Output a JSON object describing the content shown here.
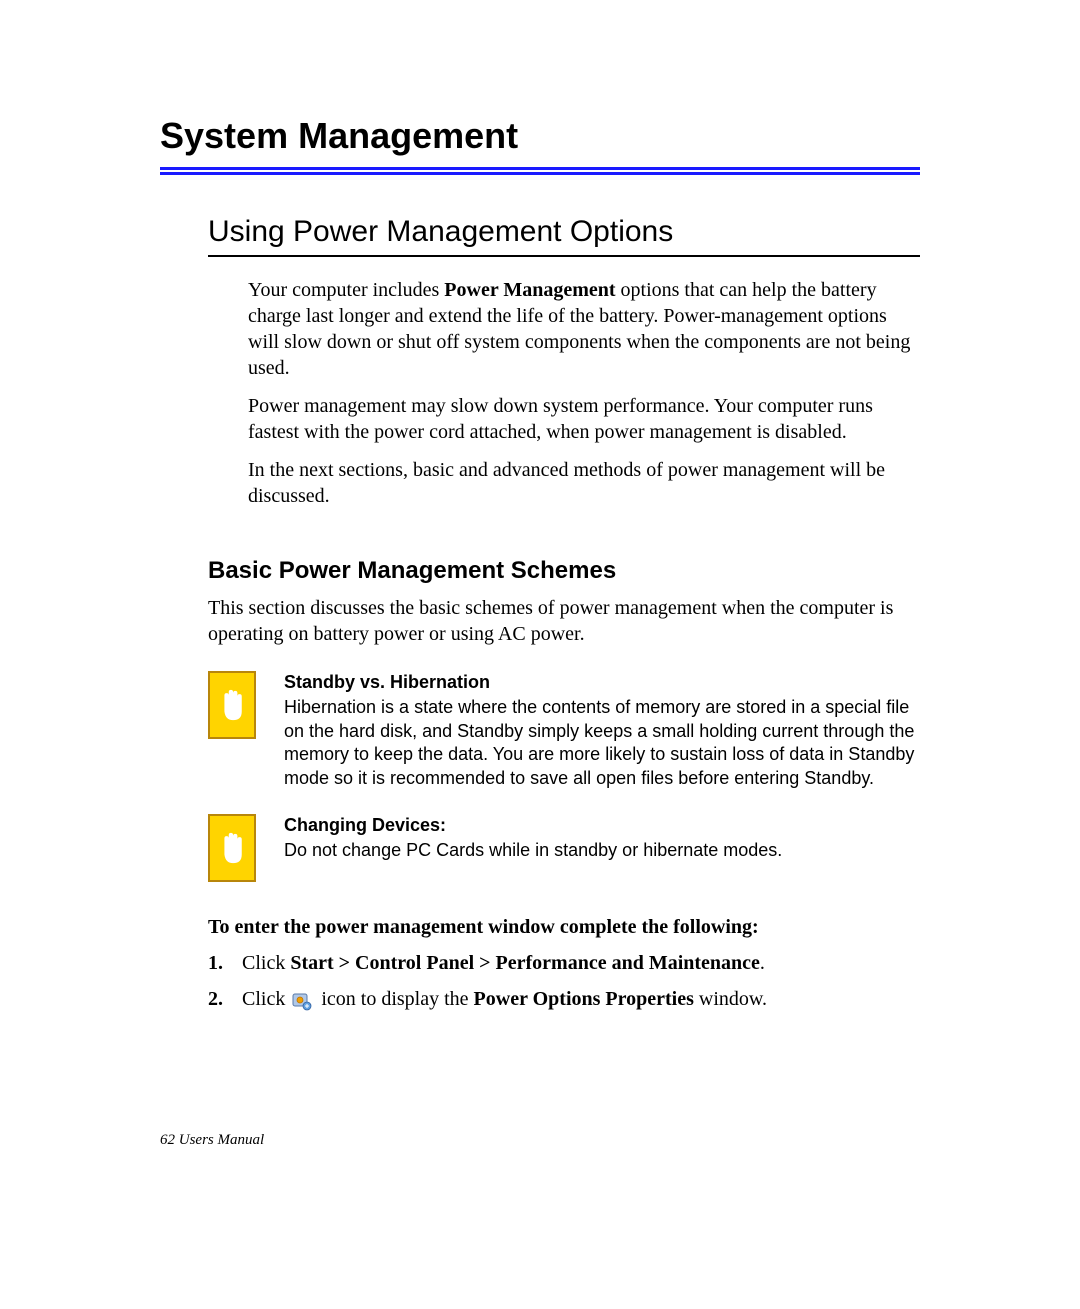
{
  "chapter_title": "System Management",
  "section_heading": "Using Power Management Options",
  "intro_paragraphs": {
    "p1_pre": "Your computer includes ",
    "p1_bold": "Power Management",
    "p1_post": " options that can help the battery charge last longer and extend the life of the battery. Power-management options will slow down or shut off system components when the components are not being used.",
    "p2": "Power management may slow down system performance. Your computer runs fastest with the power cord attached, when power management is disabled.",
    "p3": "In the next sections, basic and advanced methods of power management will be discussed."
  },
  "subheading": "Basic Power Management Schemes",
  "sub_intro": "This section discusses the basic schemes of power management when the computer is operating on battery power or using AC power.",
  "notes": [
    {
      "title": "Standby vs. Hibernation",
      "body": "Hibernation is a state where the contents of memory are stored in a special file on the hard disk, and Standby simply keeps a small holding current through the memory to keep the data. You are more likely to sustain loss of data in Standby mode so it is recommended to save all open files before entering Standby."
    },
    {
      "title": "Changing Devices:",
      "body": "Do not change PC Cards while in standby or hibernate modes."
    }
  ],
  "instructions": {
    "lead": "To enter the power management window complete the following:",
    "items": [
      {
        "num": "1.",
        "pre": "Click ",
        "bold": "Start > Control Panel > Performance and Maintenance",
        "post": "."
      },
      {
        "num": "2.",
        "pre": "Click ",
        "mid": " icon to display the ",
        "bold": "Power Options Properties",
        "post": " window."
      }
    ]
  },
  "footer": "62  Users Manual"
}
